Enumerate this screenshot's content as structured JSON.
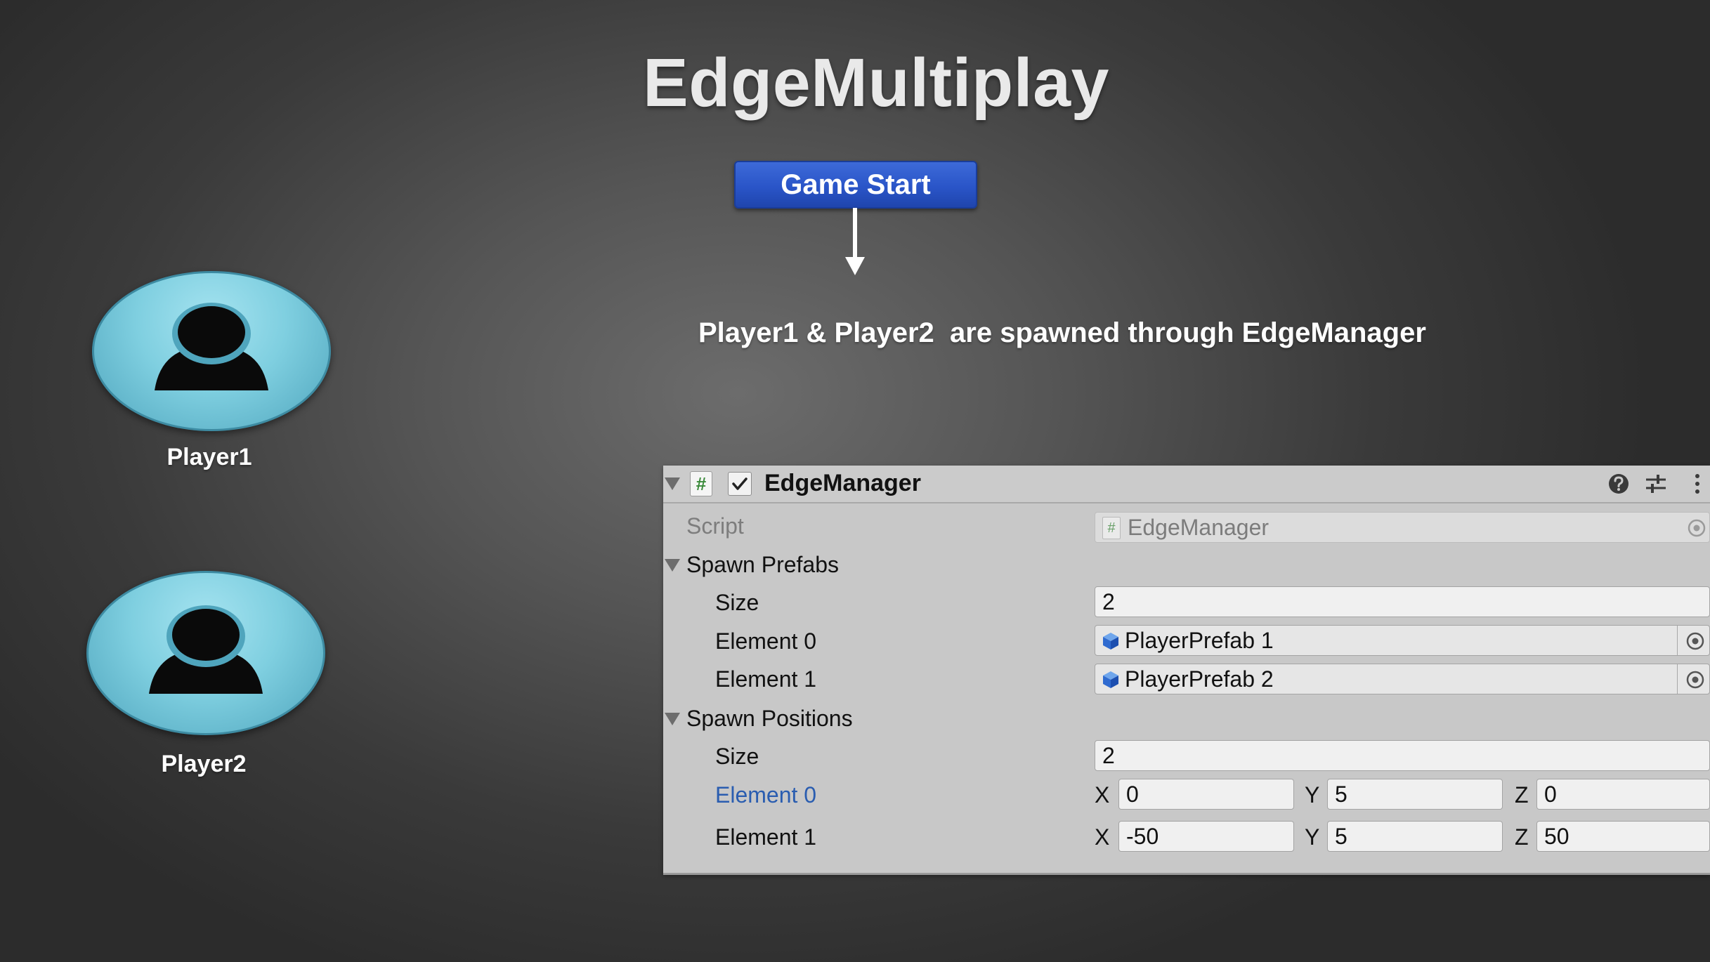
{
  "title": "EdgeMultiplay",
  "game_start_button": "Game Start",
  "caption": "Player1 & Player2  are spawned through EdgeManager",
  "players": [
    {
      "label": "Player1",
      "icon": "person-icon"
    },
    {
      "label": "Player2",
      "icon": "person-icon"
    }
  ],
  "colors": {
    "button_blue": "#2a55c8",
    "avatar_cyan": "#7fcfe0",
    "selected_label": "#2a5db0",
    "panel_bg": "#c8c8c8"
  },
  "inspector": {
    "component_name": "EdgeManager",
    "enabled": true,
    "header_icons": [
      "help-icon",
      "preset-icon",
      "more-icon"
    ],
    "script_label": "Script",
    "script_value": "EdgeManager",
    "spawn_prefabs": {
      "label": "Spawn Prefabs",
      "size_label": "Size",
      "size_value": "2",
      "elements": [
        {
          "label": "Element 0",
          "value": "PlayerPrefab 1"
        },
        {
          "label": "Element 1",
          "value": "PlayerPrefab 2"
        }
      ]
    },
    "spawn_positions": {
      "label": "Spawn Positions",
      "size_label": "Size",
      "size_value": "2",
      "axis_labels": [
        "X",
        "Y",
        "Z"
      ],
      "elements": [
        {
          "label": "Element 0",
          "x": "0",
          "y": "5",
          "z": "0",
          "selected": true
        },
        {
          "label": "Element 1",
          "x": "-50",
          "y": "5",
          "z": "50",
          "selected": false
        }
      ]
    }
  }
}
